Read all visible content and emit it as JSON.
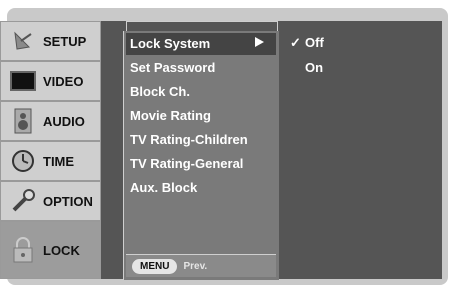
{
  "sidebar": {
    "items": [
      {
        "label": "SETUP",
        "icon": "satellite-dish-icon"
      },
      {
        "label": "VIDEO",
        "icon": "tv-screen-icon"
      },
      {
        "label": "AUDIO",
        "icon": "speaker-icon"
      },
      {
        "label": "TIME",
        "icon": "clock-icon"
      },
      {
        "label": "OPTION",
        "icon": "wrench-icon"
      },
      {
        "label": "LOCK",
        "icon": "padlock-icon"
      }
    ],
    "active": "LOCK"
  },
  "menu": {
    "items": [
      "Lock System",
      "Set Password",
      "Block Ch.",
      "Movie Rating",
      "TV Rating-Children",
      "TV Rating-General",
      "Aux. Block"
    ],
    "selected": "Lock System"
  },
  "options": {
    "values": [
      "Off",
      "On"
    ],
    "checked": "Off",
    "check_mark": "✓"
  },
  "footer": {
    "menu_button": "MENU",
    "prev_label": "Prev."
  },
  "colors": {
    "frame": "#c9c9c9",
    "panel": "#555555",
    "menu": "#7a7a7a",
    "active_tab": "#9c9c9c"
  }
}
